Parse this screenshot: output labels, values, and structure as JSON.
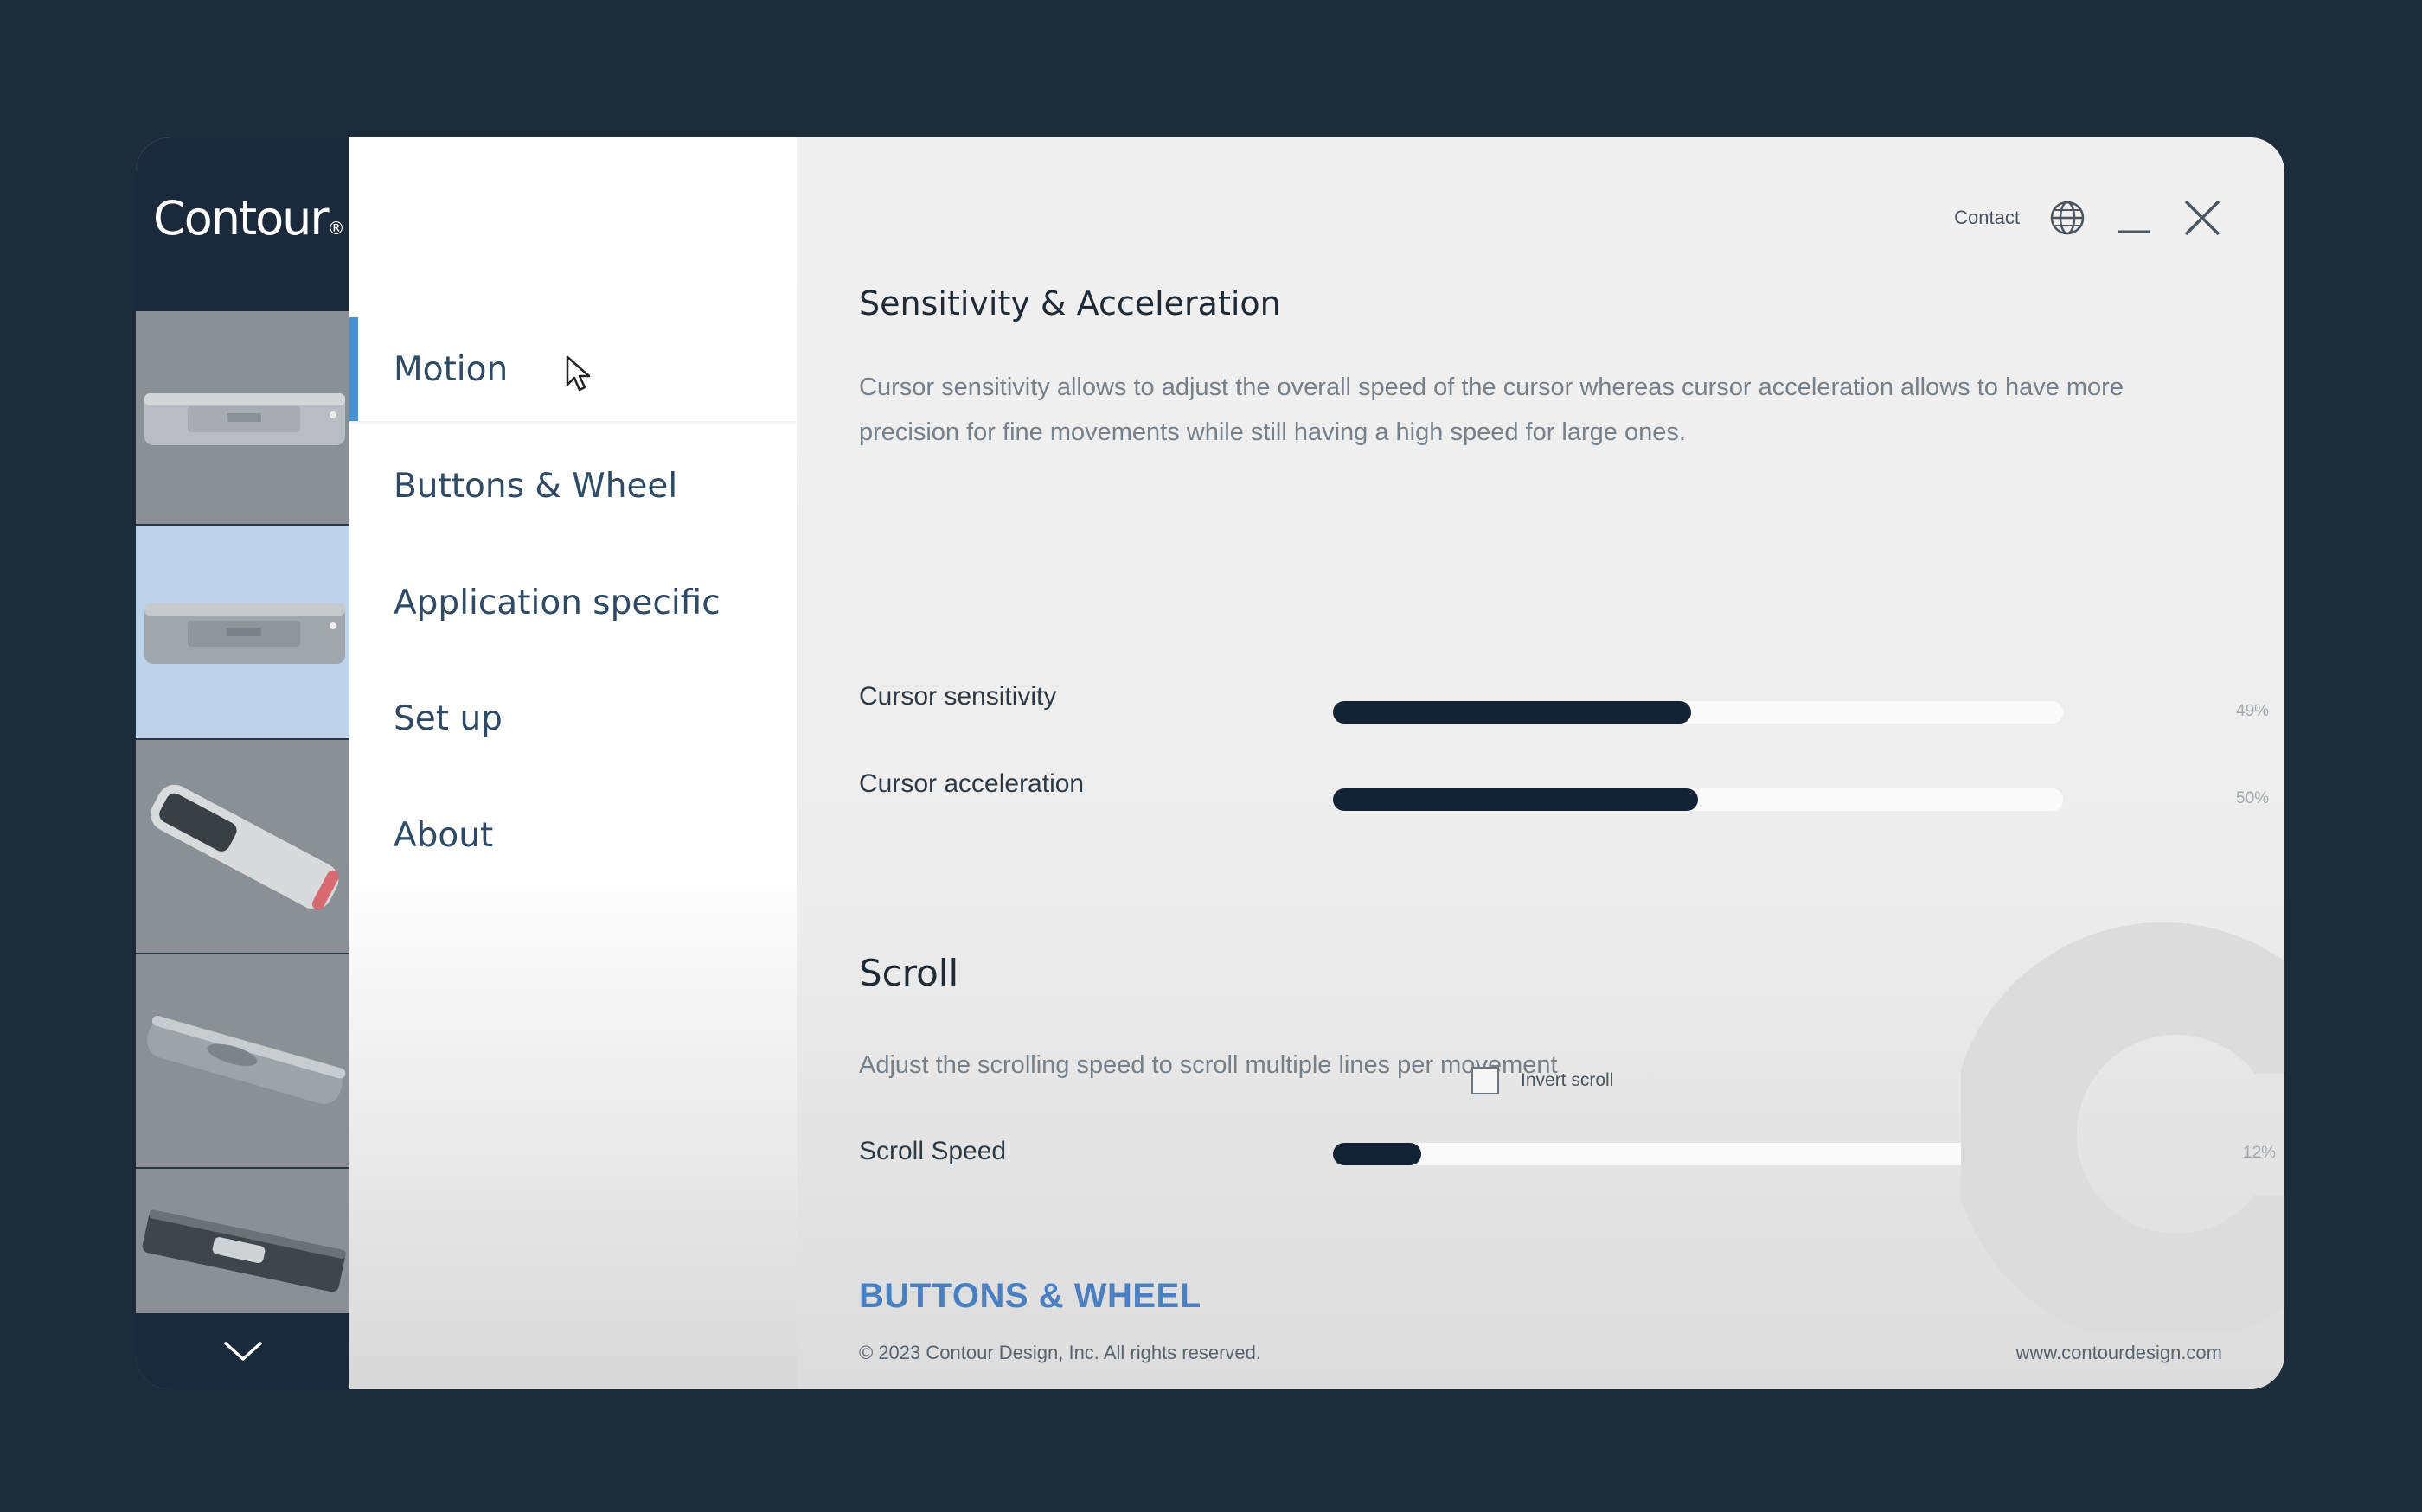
{
  "app": {
    "brand": "Contour",
    "brand_mark": "®"
  },
  "devices": [
    {
      "name": "rollermouse-wide",
      "active": false
    },
    {
      "name": "rollermouse-wide-selected",
      "active": true
    },
    {
      "name": "rollermouse-angled",
      "active": false
    },
    {
      "name": "rollermouse-flat",
      "active": false
    },
    {
      "name": "rollermouse-keyboard",
      "active": false
    }
  ],
  "nav": {
    "items": [
      {
        "label": "Motion",
        "active": true
      },
      {
        "label": "Buttons & Wheel",
        "active": false
      },
      {
        "label": "Application specific",
        "active": false
      },
      {
        "label": "Set up",
        "active": false
      },
      {
        "label": "About",
        "active": false
      }
    ]
  },
  "topbar": {
    "contact": "Contact",
    "icons": [
      "globe-icon",
      "minimize-icon",
      "close-icon"
    ]
  },
  "sensitivity": {
    "title": "Sensitivity & Acceleration",
    "description": "Cursor sensitivity allows to adjust the overall speed of the cursor whereas cursor acceleration allows to have more precision for fine movements while still having a high speed for large ones.",
    "sliders": [
      {
        "label": "Cursor sensitivity",
        "value": 49,
        "value_label": "49%"
      },
      {
        "label": "Cursor acceleration",
        "value": 50,
        "value_label": "50%"
      }
    ]
  },
  "scroll": {
    "title": "Scroll",
    "description": "Adjust the scrolling speed to scroll multiple lines per movement",
    "slider": {
      "label": "Scroll Speed",
      "value": 12,
      "value_label": "12%"
    },
    "invert": {
      "label": "Invert scroll",
      "checked": false
    }
  },
  "footer": {
    "next_section": "BUTTONS & WHEEL",
    "copyright": "© 2023 Contour Design, Inc. All rights reserved.",
    "website": "www.contourdesign.com"
  },
  "colors": {
    "background": "#1d2c3b",
    "accent": "#4a8ed2",
    "slider_fill": "#132234",
    "link": "#4a7fc1"
  }
}
